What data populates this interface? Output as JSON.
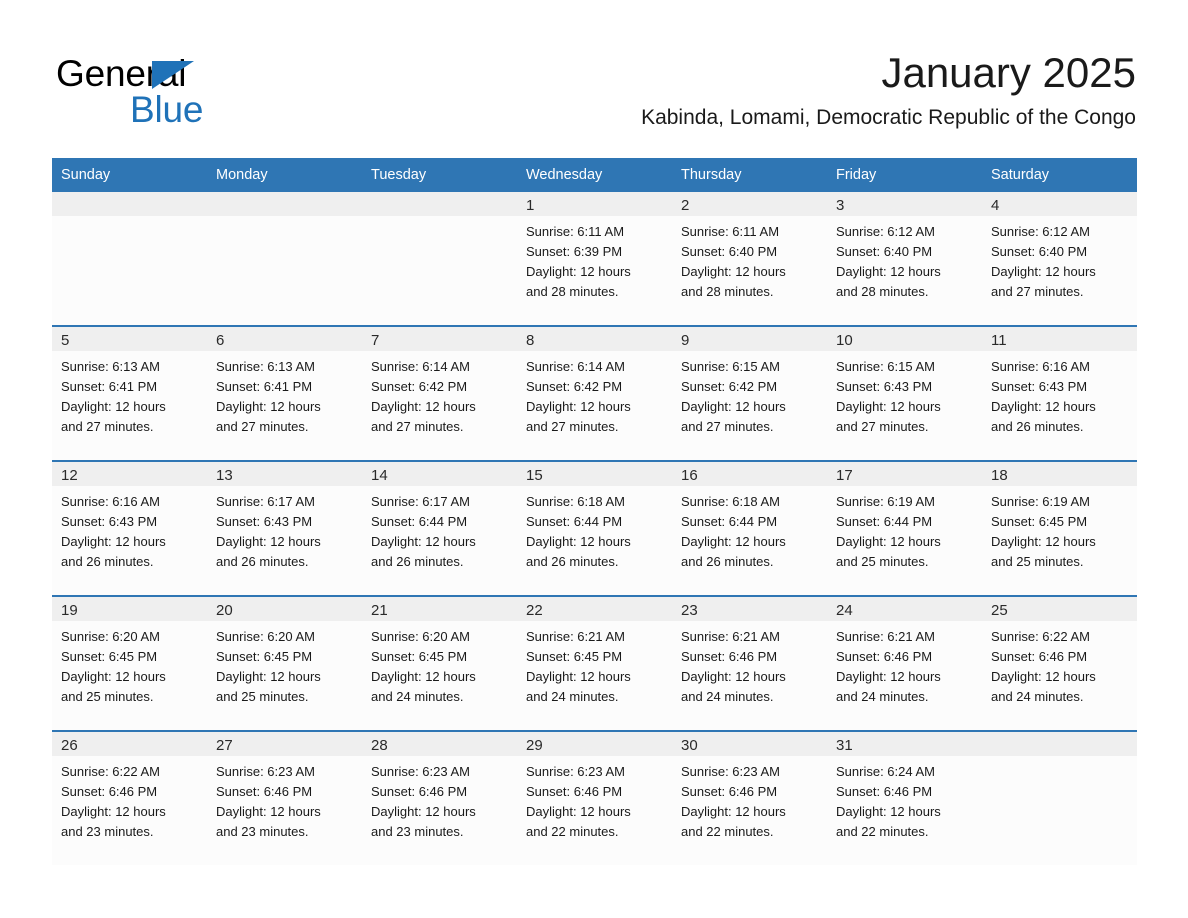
{
  "brand": {
    "name_part1": "General",
    "name_part2": "Blue",
    "triangle_icon": "triangle-icon",
    "accent_color": "#1f72b8"
  },
  "header": {
    "month_title": "January 2025",
    "location": "Kabinda, Lomami, Democratic Republic of the Congo"
  },
  "theme": {
    "header_blue": "#2f76b4",
    "daynum_band": "#efefef",
    "cell_background": "#fcfcfc",
    "page_background": "#ffffff"
  },
  "calendar": {
    "weekday_headers": [
      "Sunday",
      "Monday",
      "Tuesday",
      "Wednesday",
      "Thursday",
      "Friday",
      "Saturday"
    ],
    "labels": {
      "sunrise_prefix": "Sunrise:",
      "sunset_prefix": "Sunset:",
      "daylight_prefix": "Daylight:"
    },
    "weeks": [
      [
        {
          "day": "",
          "empty": true,
          "sunrise": "",
          "sunset": "",
          "daylight_line1": "",
          "daylight_line2": ""
        },
        {
          "day": "",
          "empty": true,
          "sunrise": "",
          "sunset": "",
          "daylight_line1": "",
          "daylight_line2": ""
        },
        {
          "day": "",
          "empty": true,
          "sunrise": "",
          "sunset": "",
          "daylight_line1": "",
          "daylight_line2": ""
        },
        {
          "day": "1",
          "empty": false,
          "sunrise": "Sunrise: 6:11 AM",
          "sunset": "Sunset: 6:39 PM",
          "daylight_line1": "Daylight: 12 hours",
          "daylight_line2": "and 28 minutes."
        },
        {
          "day": "2",
          "empty": false,
          "sunrise": "Sunrise: 6:11 AM",
          "sunset": "Sunset: 6:40 PM",
          "daylight_line1": "Daylight: 12 hours",
          "daylight_line2": "and 28 minutes."
        },
        {
          "day": "3",
          "empty": false,
          "sunrise": "Sunrise: 6:12 AM",
          "sunset": "Sunset: 6:40 PM",
          "daylight_line1": "Daylight: 12 hours",
          "daylight_line2": "and 28 minutes."
        },
        {
          "day": "4",
          "empty": false,
          "sunrise": "Sunrise: 6:12 AM",
          "sunset": "Sunset: 6:40 PM",
          "daylight_line1": "Daylight: 12 hours",
          "daylight_line2": "and 27 minutes."
        }
      ],
      [
        {
          "day": "5",
          "empty": false,
          "sunrise": "Sunrise: 6:13 AM",
          "sunset": "Sunset: 6:41 PM",
          "daylight_line1": "Daylight: 12 hours",
          "daylight_line2": "and 27 minutes."
        },
        {
          "day": "6",
          "empty": false,
          "sunrise": "Sunrise: 6:13 AM",
          "sunset": "Sunset: 6:41 PM",
          "daylight_line1": "Daylight: 12 hours",
          "daylight_line2": "and 27 minutes."
        },
        {
          "day": "7",
          "empty": false,
          "sunrise": "Sunrise: 6:14 AM",
          "sunset": "Sunset: 6:42 PM",
          "daylight_line1": "Daylight: 12 hours",
          "daylight_line2": "and 27 minutes."
        },
        {
          "day": "8",
          "empty": false,
          "sunrise": "Sunrise: 6:14 AM",
          "sunset": "Sunset: 6:42 PM",
          "daylight_line1": "Daylight: 12 hours",
          "daylight_line2": "and 27 minutes."
        },
        {
          "day": "9",
          "empty": false,
          "sunrise": "Sunrise: 6:15 AM",
          "sunset": "Sunset: 6:42 PM",
          "daylight_line1": "Daylight: 12 hours",
          "daylight_line2": "and 27 minutes."
        },
        {
          "day": "10",
          "empty": false,
          "sunrise": "Sunrise: 6:15 AM",
          "sunset": "Sunset: 6:43 PM",
          "daylight_line1": "Daylight: 12 hours",
          "daylight_line2": "and 27 minutes."
        },
        {
          "day": "11",
          "empty": false,
          "sunrise": "Sunrise: 6:16 AM",
          "sunset": "Sunset: 6:43 PM",
          "daylight_line1": "Daylight: 12 hours",
          "daylight_line2": "and 26 minutes."
        }
      ],
      [
        {
          "day": "12",
          "empty": false,
          "sunrise": "Sunrise: 6:16 AM",
          "sunset": "Sunset: 6:43 PM",
          "daylight_line1": "Daylight: 12 hours",
          "daylight_line2": "and 26 minutes."
        },
        {
          "day": "13",
          "empty": false,
          "sunrise": "Sunrise: 6:17 AM",
          "sunset": "Sunset: 6:43 PM",
          "daylight_line1": "Daylight: 12 hours",
          "daylight_line2": "and 26 minutes."
        },
        {
          "day": "14",
          "empty": false,
          "sunrise": "Sunrise: 6:17 AM",
          "sunset": "Sunset: 6:44 PM",
          "daylight_line1": "Daylight: 12 hours",
          "daylight_line2": "and 26 minutes."
        },
        {
          "day": "15",
          "empty": false,
          "sunrise": "Sunrise: 6:18 AM",
          "sunset": "Sunset: 6:44 PM",
          "daylight_line1": "Daylight: 12 hours",
          "daylight_line2": "and 26 minutes."
        },
        {
          "day": "16",
          "empty": false,
          "sunrise": "Sunrise: 6:18 AM",
          "sunset": "Sunset: 6:44 PM",
          "daylight_line1": "Daylight: 12 hours",
          "daylight_line2": "and 26 minutes."
        },
        {
          "day": "17",
          "empty": false,
          "sunrise": "Sunrise: 6:19 AM",
          "sunset": "Sunset: 6:44 PM",
          "daylight_line1": "Daylight: 12 hours",
          "daylight_line2": "and 25 minutes."
        },
        {
          "day": "18",
          "empty": false,
          "sunrise": "Sunrise: 6:19 AM",
          "sunset": "Sunset: 6:45 PM",
          "daylight_line1": "Daylight: 12 hours",
          "daylight_line2": "and 25 minutes."
        }
      ],
      [
        {
          "day": "19",
          "empty": false,
          "sunrise": "Sunrise: 6:20 AM",
          "sunset": "Sunset: 6:45 PM",
          "daylight_line1": "Daylight: 12 hours",
          "daylight_line2": "and 25 minutes."
        },
        {
          "day": "20",
          "empty": false,
          "sunrise": "Sunrise: 6:20 AM",
          "sunset": "Sunset: 6:45 PM",
          "daylight_line1": "Daylight: 12 hours",
          "daylight_line2": "and 25 minutes."
        },
        {
          "day": "21",
          "empty": false,
          "sunrise": "Sunrise: 6:20 AM",
          "sunset": "Sunset: 6:45 PM",
          "daylight_line1": "Daylight: 12 hours",
          "daylight_line2": "and 24 minutes."
        },
        {
          "day": "22",
          "empty": false,
          "sunrise": "Sunrise: 6:21 AM",
          "sunset": "Sunset: 6:45 PM",
          "daylight_line1": "Daylight: 12 hours",
          "daylight_line2": "and 24 minutes."
        },
        {
          "day": "23",
          "empty": false,
          "sunrise": "Sunrise: 6:21 AM",
          "sunset": "Sunset: 6:46 PM",
          "daylight_line1": "Daylight: 12 hours",
          "daylight_line2": "and 24 minutes."
        },
        {
          "day": "24",
          "empty": false,
          "sunrise": "Sunrise: 6:21 AM",
          "sunset": "Sunset: 6:46 PM",
          "daylight_line1": "Daylight: 12 hours",
          "daylight_line2": "and 24 minutes."
        },
        {
          "day": "25",
          "empty": false,
          "sunrise": "Sunrise: 6:22 AM",
          "sunset": "Sunset: 6:46 PM",
          "daylight_line1": "Daylight: 12 hours",
          "daylight_line2": "and 24 minutes."
        }
      ],
      [
        {
          "day": "26",
          "empty": false,
          "sunrise": "Sunrise: 6:22 AM",
          "sunset": "Sunset: 6:46 PM",
          "daylight_line1": "Daylight: 12 hours",
          "daylight_line2": "and 23 minutes."
        },
        {
          "day": "27",
          "empty": false,
          "sunrise": "Sunrise: 6:23 AM",
          "sunset": "Sunset: 6:46 PM",
          "daylight_line1": "Daylight: 12 hours",
          "daylight_line2": "and 23 minutes."
        },
        {
          "day": "28",
          "empty": false,
          "sunrise": "Sunrise: 6:23 AM",
          "sunset": "Sunset: 6:46 PM",
          "daylight_line1": "Daylight: 12 hours",
          "daylight_line2": "and 23 minutes."
        },
        {
          "day": "29",
          "empty": false,
          "sunrise": "Sunrise: 6:23 AM",
          "sunset": "Sunset: 6:46 PM",
          "daylight_line1": "Daylight: 12 hours",
          "daylight_line2": "and 22 minutes."
        },
        {
          "day": "30",
          "empty": false,
          "sunrise": "Sunrise: 6:23 AM",
          "sunset": "Sunset: 6:46 PM",
          "daylight_line1": "Daylight: 12 hours",
          "daylight_line2": "and 22 minutes."
        },
        {
          "day": "31",
          "empty": false,
          "sunrise": "Sunrise: 6:24 AM",
          "sunset": "Sunset: 6:46 PM",
          "daylight_line1": "Daylight: 12 hours",
          "daylight_line2": "and 22 minutes."
        },
        {
          "day": "",
          "empty": true,
          "sunrise": "",
          "sunset": "",
          "daylight_line1": "",
          "daylight_line2": ""
        }
      ]
    ]
  }
}
